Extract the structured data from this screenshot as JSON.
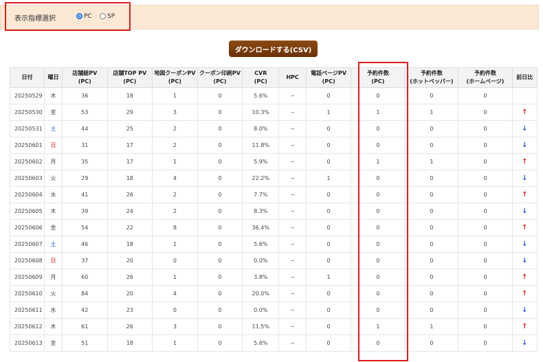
{
  "filter": {
    "label": "表示指標選択",
    "options": [
      {
        "label": "PC",
        "checked": true
      },
      {
        "label": "SP",
        "checked": false
      }
    ]
  },
  "download_label": "ダウンロードする(CSV)",
  "colors": {
    "saturday": "#1a5dc8",
    "sunday": "#d01a1a",
    "up": "#d0281b",
    "down": "#1a5dc8",
    "highlight": "#e01b1b"
  },
  "table": {
    "headers": [
      [
        "日付"
      ],
      [
        "曜日"
      ],
      [
        "店舗総PV",
        "(PC)"
      ],
      [
        "店舗TOP PV",
        "(PC)"
      ],
      [
        "地図クーポンPV",
        "(PC)"
      ],
      [
        "クーポン印刷PV",
        "(PC)"
      ],
      [
        "CVR",
        "(PC)"
      ],
      [
        "HPC"
      ],
      [
        "電話ページPV",
        "(PC)"
      ],
      [
        "予約件数",
        "(PC)"
      ],
      [
        "予約件数",
        "(ホットペッパー)"
      ],
      [
        "予約件数",
        "(ホームページ)"
      ],
      [
        "前日比"
      ]
    ],
    "rows": [
      {
        "date": "20250529",
        "day": "木",
        "dayType": "",
        "total": "36",
        "top": "18",
        "map": "1",
        "print": "0",
        "cvr": "5.6%",
        "hpc": "−",
        "tel": "0",
        "res": "0",
        "hp": "0",
        "home": "0",
        "trend": ""
      },
      {
        "date": "20250530",
        "day": "金",
        "dayType": "",
        "total": "53",
        "top": "29",
        "map": "3",
        "print": "0",
        "cvr": "10.3%",
        "hpc": "−",
        "tel": "1",
        "res": "1",
        "hp": "1",
        "home": "0",
        "trend": "up"
      },
      {
        "date": "20250531",
        "day": "土",
        "dayType": "sat",
        "total": "44",
        "top": "25",
        "map": "2",
        "print": "0",
        "cvr": "8.0%",
        "hpc": "−",
        "tel": "0",
        "res": "0",
        "hp": "0",
        "home": "0",
        "trend": "down"
      },
      {
        "date": "20250601",
        "day": "日",
        "dayType": "sun",
        "total": "31",
        "top": "17",
        "map": "2",
        "print": "0",
        "cvr": "11.8%",
        "hpc": "−",
        "tel": "0",
        "res": "0",
        "hp": "0",
        "home": "0",
        "trend": "down"
      },
      {
        "date": "20250602",
        "day": "月",
        "dayType": "",
        "total": "35",
        "top": "17",
        "map": "1",
        "print": "0",
        "cvr": "5.9%",
        "hpc": "−",
        "tel": "0",
        "res": "1",
        "hp": "1",
        "home": "0",
        "trend": "up"
      },
      {
        "date": "20250603",
        "day": "火",
        "dayType": "",
        "total": "29",
        "top": "18",
        "map": "4",
        "print": "0",
        "cvr": "22.2%",
        "hpc": "−",
        "tel": "1",
        "res": "0",
        "hp": "0",
        "home": "0",
        "trend": "down"
      },
      {
        "date": "20250604",
        "day": "水",
        "dayType": "",
        "total": "41",
        "top": "26",
        "map": "2",
        "print": "0",
        "cvr": "7.7%",
        "hpc": "−",
        "tel": "0",
        "res": "0",
        "hp": "0",
        "home": "0",
        "trend": "up"
      },
      {
        "date": "20250605",
        "day": "木",
        "dayType": "",
        "total": "39",
        "top": "24",
        "map": "2",
        "print": "0",
        "cvr": "8.3%",
        "hpc": "−",
        "tel": "0",
        "res": "0",
        "hp": "0",
        "home": "0",
        "trend": "down"
      },
      {
        "date": "20250606",
        "day": "金",
        "dayType": "",
        "total": "54",
        "top": "22",
        "map": "8",
        "print": "0",
        "cvr": "36.4%",
        "hpc": "−",
        "tel": "0",
        "res": "0",
        "hp": "0",
        "home": "0",
        "trend": "up"
      },
      {
        "date": "20250607",
        "day": "土",
        "dayType": "sat",
        "total": "46",
        "top": "18",
        "map": "1",
        "print": "0",
        "cvr": "5.6%",
        "hpc": "−",
        "tel": "0",
        "res": "0",
        "hp": "0",
        "home": "0",
        "trend": "down"
      },
      {
        "date": "20250608",
        "day": "日",
        "dayType": "sun",
        "total": "37",
        "top": "20",
        "map": "0",
        "print": "0",
        "cvr": "0.0%",
        "hpc": "−",
        "tel": "0",
        "res": "0",
        "hp": "0",
        "home": "0",
        "trend": "down"
      },
      {
        "date": "20250609",
        "day": "月",
        "dayType": "",
        "total": "60",
        "top": "26",
        "map": "1",
        "print": "0",
        "cvr": "3.8%",
        "hpc": "−",
        "tel": "1",
        "res": "0",
        "hp": "0",
        "home": "0",
        "trend": "up"
      },
      {
        "date": "20250610",
        "day": "火",
        "dayType": "",
        "total": "84",
        "top": "20",
        "map": "4",
        "print": "0",
        "cvr": "20.0%",
        "hpc": "−",
        "tel": "0",
        "res": "0",
        "hp": "0",
        "home": "0",
        "trend": "up"
      },
      {
        "date": "20250611",
        "day": "水",
        "dayType": "",
        "total": "42",
        "top": "23",
        "map": "0",
        "print": "0",
        "cvr": "0.0%",
        "hpc": "−",
        "tel": "0",
        "res": "0",
        "hp": "0",
        "home": "0",
        "trend": "down"
      },
      {
        "date": "20250612",
        "day": "木",
        "dayType": "",
        "total": "61",
        "top": "26",
        "map": "3",
        "print": "0",
        "cvr": "11.5%",
        "hpc": "−",
        "tel": "0",
        "res": "1",
        "hp": "1",
        "home": "0",
        "trend": "up"
      },
      {
        "date": "20250613",
        "day": "金",
        "dayType": "",
        "total": "51",
        "top": "18",
        "map": "1",
        "print": "0",
        "cvr": "5.6%",
        "hpc": "−",
        "tel": "0",
        "res": "0",
        "hp": "0",
        "home": "0",
        "trend": "down"
      }
    ]
  }
}
